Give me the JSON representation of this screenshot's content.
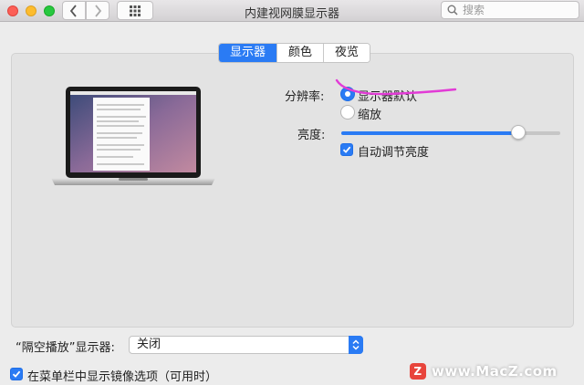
{
  "window": {
    "title": "内建视网膜显示器",
    "search_placeholder": "搜索"
  },
  "tabs": [
    {
      "label": "显示器",
      "active": true
    },
    {
      "label": "颜色",
      "active": false
    },
    {
      "label": "夜览",
      "active": false
    }
  ],
  "resolution": {
    "label": "分辨率:",
    "options": [
      {
        "label": "显示器默认",
        "selected": true
      },
      {
        "label": "缩放",
        "selected": false
      }
    ]
  },
  "brightness": {
    "label": "亮度:",
    "value": 0.81,
    "auto_label": "自动调节亮度",
    "auto_checked": true
  },
  "airplay": {
    "label": "“隔空播放”显示器:",
    "value": "关闭"
  },
  "mirror": {
    "label": "在菜单栏中显示镜像选项（可用时）",
    "checked": true
  },
  "watermark": "www.MacZ.com",
  "colors": {
    "accent": "#2a7bf4",
    "annotation": "#e23bd6"
  }
}
